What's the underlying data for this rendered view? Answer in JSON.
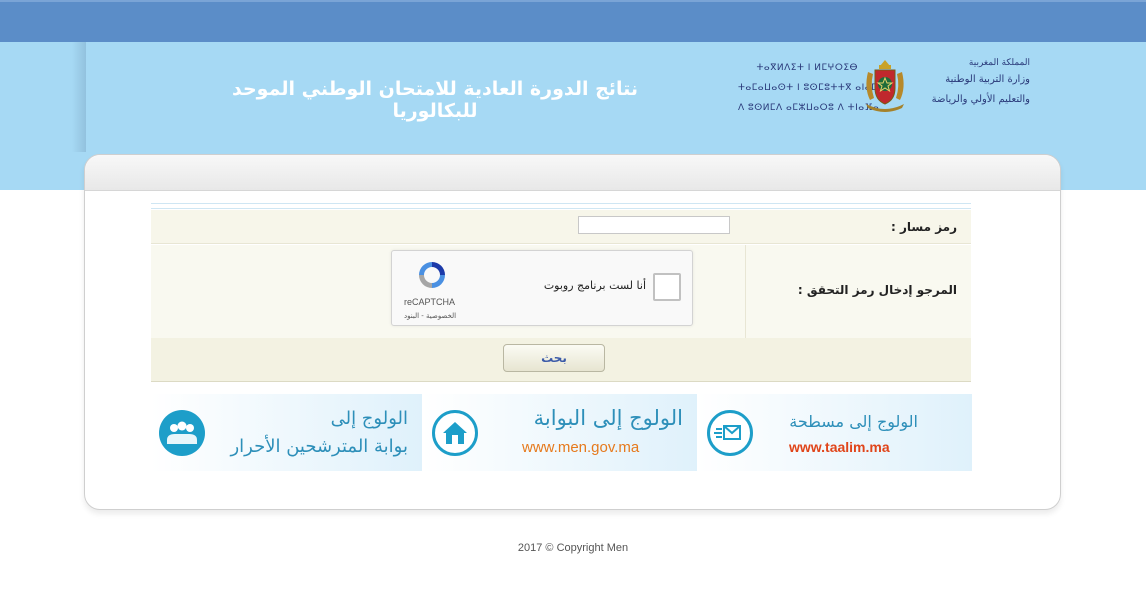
{
  "header": {
    "title": "نتائج الدورة العادية للامتحان الوطني الموحد للبكالوريا",
    "ministry_ar": [
      "المملكة المغربية",
      "وزارة التربية الوطنية",
      "والتعليم الأولي والرياضة"
    ],
    "ministry_tf": [
      "ⵜⴰⴳⵍⴷⵉⵜ ⵏ ⵍⵎⵖⵔⵉⴱ",
      "ⵜⴰⵎⴰⵡⴰⵙⵜ ⵏ ⵓⵙⵎⵓⵜⵜⴳ ⴰⵏⴰⵎⵓⵔ",
      "ⴷ ⵓⵙⵍⵎⴷ ⴰⵎⵣⵡⴰⵔⵓ ⴷ ⵜⵏⴰⴼⴰ"
    ],
    "brand_color": "#5b8dc8",
    "header_color": "#a6d9f4"
  },
  "form": {
    "massar_label": "رمز مسار :",
    "massar_value": "",
    "captcha_label": "المرجو إدخال رمز التحقق :",
    "captcha": {
      "checkbox_text": "أنا لست برنامج روبوت",
      "brand": "reCAPTCHA",
      "links": "الخصوصية - البنود",
      "checked": false
    },
    "search_label": "بحث"
  },
  "banners": [
    {
      "line1": "الولوج إلى",
      "line2": "بوابة المترشحين الأحرار",
      "icon": "candidates-icon"
    },
    {
      "line1": "الولوج إلى البوابة",
      "url": "www.men.gov.ma",
      "icon": "home-icon"
    },
    {
      "line1": "الولوج إلى مسطحة",
      "url": "www.taalim.ma",
      "icon": "mail-icon"
    }
  ],
  "footer": {
    "copyright": "2017 © Copyright Men"
  }
}
